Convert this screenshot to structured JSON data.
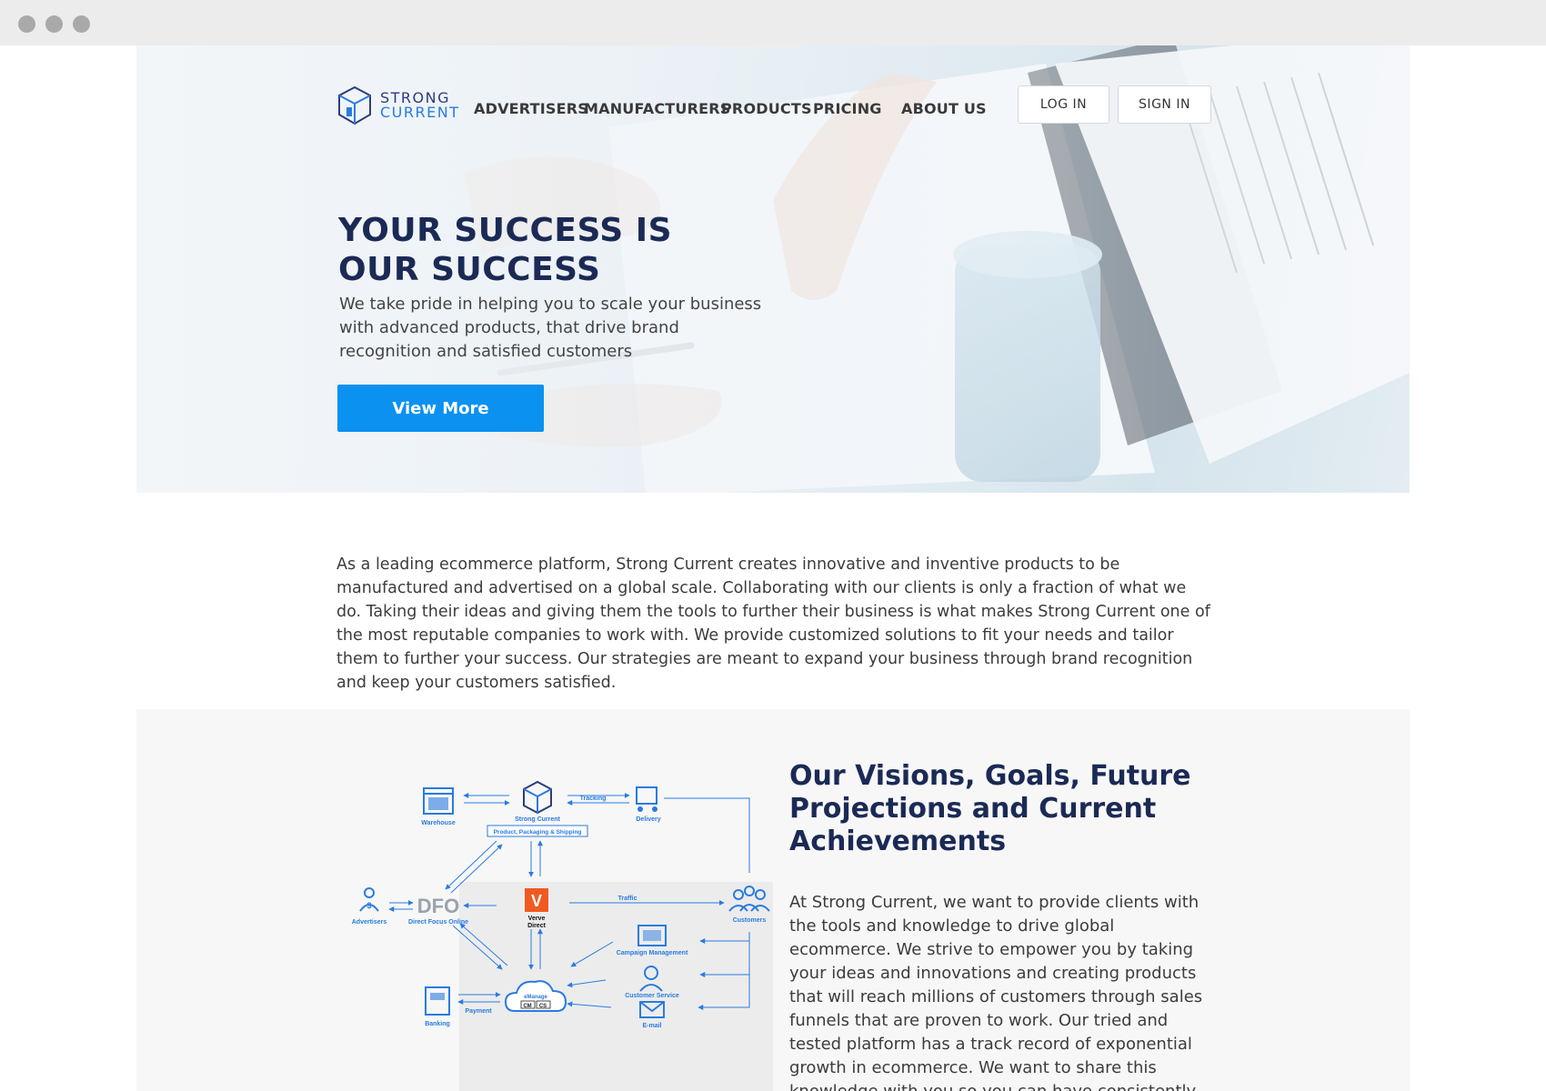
{
  "nav": {
    "logo_line1": "STRONG",
    "logo_line2": "CURRENT",
    "links": [
      "ADVERTISERS",
      "MANUFACTURERS",
      "PRODUCTS",
      "PRICING",
      "ABOUT US"
    ],
    "login": "LOG IN",
    "signin": "SIGN IN"
  },
  "hero": {
    "title_line1": "YOUR SUCCESS IS",
    "title_line2": "OUR SUCCESS",
    "subtitle": "We take pride in helping you to scale your business with advanced products, that drive brand recognition and satisfied customers",
    "cta": "View More"
  },
  "intro": {
    "text": "As a leading ecommerce platform, Strong Current creates innovative and inventive products to be manufactured and advertised on a global scale. Collaborating with our clients is only a fraction of what we do. Taking their ideas and giving them the tools to further their business is what makes Strong Current one of the most reputable companies to work with. We provide customized solutions to fit your needs and tailor them to further your success. Our strategies are meant to expand your business through brand recognition and keep your customers satisfied."
  },
  "vision": {
    "title": "Our Visions, Goals, Future Projections and Current Achievements",
    "body": "At Strong Current, we want to provide clients with the tools and knowledge to drive global ecommerce. We strive to empower you by taking your ideas and innovations and creating products that will reach millions of customers through sales funnels that are proven to work. Our tried and tested platform has a track record of exponential growth in ecommerce. We want to share this knowledge with you so you can have consistently growing profits and repeat happy"
  },
  "diagram": {
    "warehouse": "Warehouse",
    "strong_current": "Strong Current",
    "pps": "Product, Packaging & Shipping",
    "tracking": "Tracking",
    "delivery": "Delivery",
    "advertisers": "Advertisers",
    "dfo": "DFO",
    "dfo_label": "Direct Focus Online",
    "verve1": "Verve",
    "verve2": "Direct",
    "traffic": "Traffic",
    "customers": "Customers",
    "campaign": "Campaign Management",
    "customer_service": "Customer Service",
    "email": "E-mail",
    "emanage": "eManage",
    "cm": "CM",
    "cs": "CS",
    "banking": "Banking",
    "payment": "Payment"
  },
  "colors": {
    "accent": "#0b91f0",
    "navy": "#1b2a55",
    "diagram_blue": "#2a7be0"
  }
}
